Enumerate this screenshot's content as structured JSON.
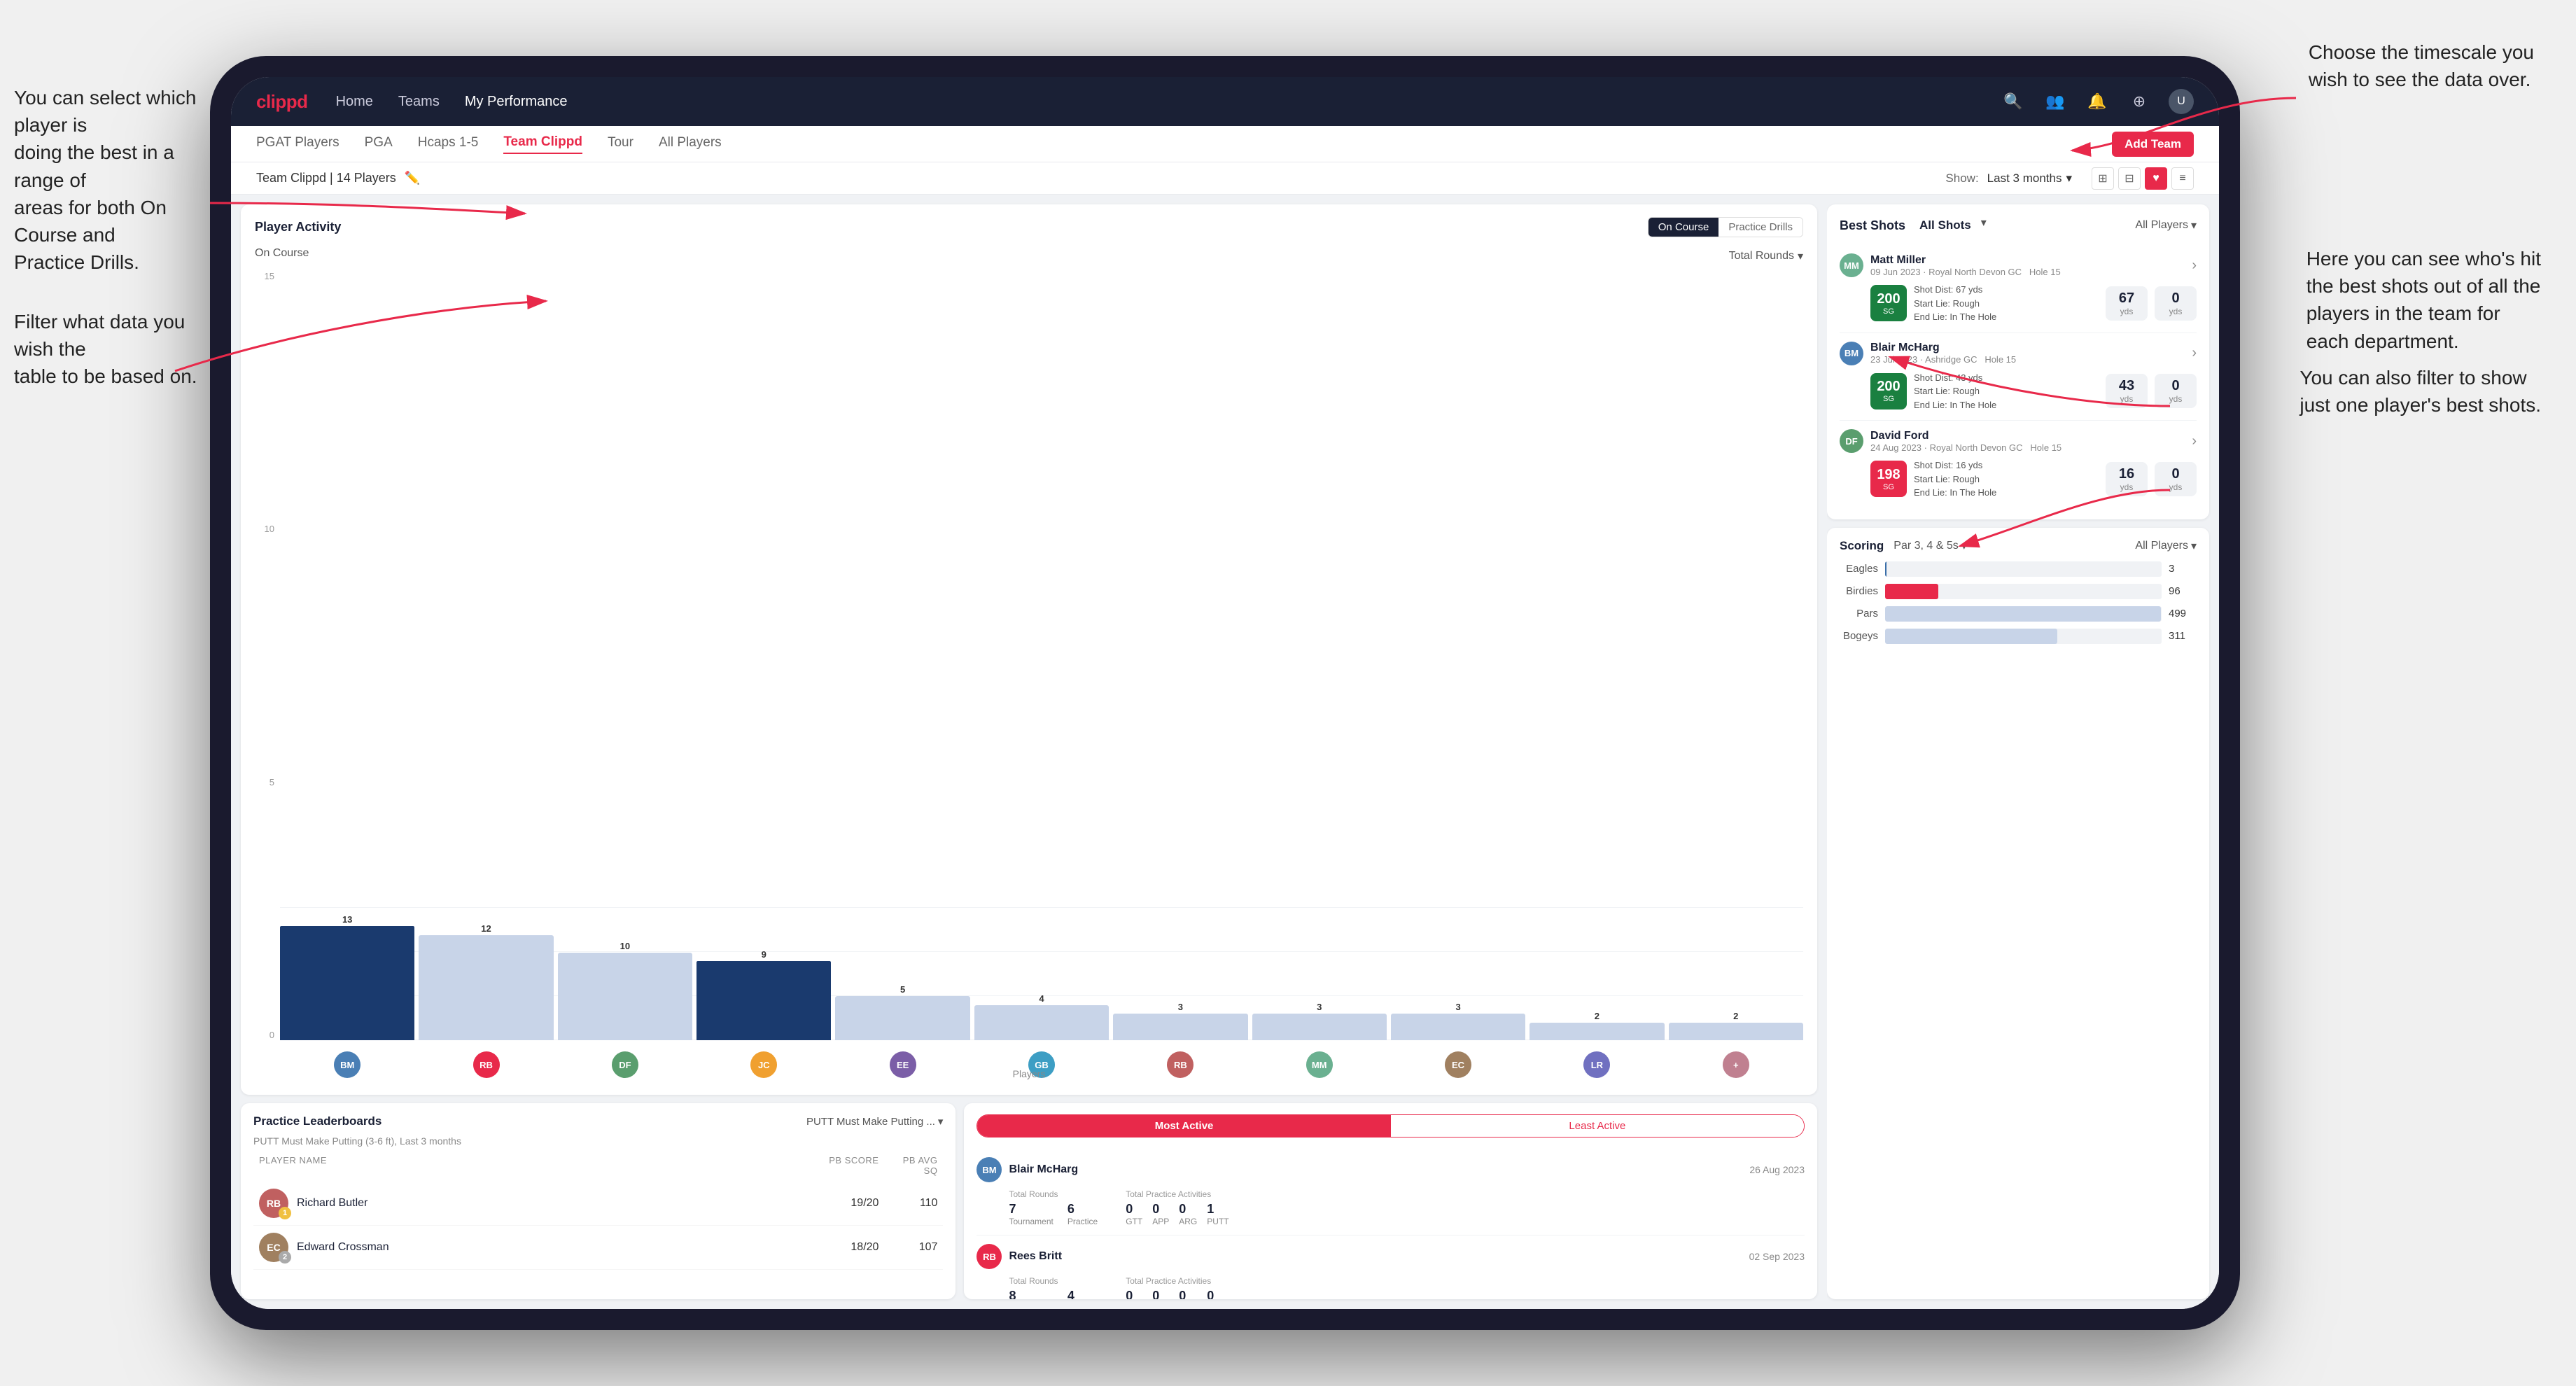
{
  "annotations": {
    "top_right": "Choose the timescale you\nwish to see the data over.",
    "top_left": "You can select which player is\ndoing the best in a range of\nareas for both On Course and\nPractice Drills.",
    "bottom_left": "Filter what data you wish the\ntable to be based on.",
    "right_mid": "Here you can see who's hit\nthe best shots out of all the\nplayers in the team for\neach department.",
    "right_bot": "You can also filter to show\njust one player's best shots."
  },
  "nav": {
    "logo": "clippd",
    "links": [
      "Home",
      "Teams",
      "My Performance"
    ],
    "icons": [
      "🔍",
      "👤",
      "🔔",
      "⊕",
      "👤"
    ]
  },
  "sub_nav": {
    "links": [
      "PGAT Players",
      "PGA",
      "Hcaps 1-5",
      "Team Clippd",
      "Tour",
      "All Players"
    ],
    "active": "Team Clippd",
    "add_btn": "Add Team"
  },
  "team_header": {
    "team_name": "Team Clippd | 14 Players",
    "show_label": "Show:",
    "show_value": "Last 3 months",
    "view_icons": [
      "⊞",
      "⊟",
      "♥",
      "≡"
    ]
  },
  "activity": {
    "title": "Player Activity",
    "toggle": [
      "On Course",
      "Practice Drills"
    ],
    "active_toggle": "On Course",
    "section": "On Course",
    "chart_filter": "Total Rounds",
    "x_axis_label": "Players",
    "y_labels": [
      "15",
      "10",
      "5",
      "0"
    ],
    "bars": [
      {
        "label": "13",
        "player": "B. McHarg",
        "height": 87,
        "highlighted": true,
        "color": "#1a3a6e"
      },
      {
        "label": "12",
        "player": "R. Britt",
        "height": 80,
        "highlighted": false
      },
      {
        "label": "10",
        "player": "D. Ford",
        "height": 67,
        "highlighted": false
      },
      {
        "label": "9",
        "player": "J. Coles",
        "height": 60,
        "highlighted": true
      },
      {
        "label": "5",
        "player": "E. Ebert",
        "height": 33,
        "highlighted": false
      },
      {
        "label": "4",
        "player": "G. Billingham",
        "height": 27,
        "highlighted": false
      },
      {
        "label": "3",
        "player": "R. Butler",
        "height": 20,
        "highlighted": false
      },
      {
        "label": "3",
        "player": "M. Miller",
        "height": 20,
        "highlighted": false
      },
      {
        "label": "3",
        "player": "E. Crossman",
        "height": 20,
        "highlighted": false
      },
      {
        "label": "2",
        "player": "L. Robertson",
        "height": 13,
        "highlighted": false
      },
      {
        "label": "2",
        "player": "other",
        "height": 13,
        "highlighted": false
      }
    ],
    "player_colors": [
      "#4a7fb5",
      "#e8294a",
      "#5a9e6e",
      "#f0a030",
      "#7b5ea7",
      "#3d9ec4",
      "#c06060",
      "#6ab090",
      "#a08060",
      "#7070c0",
      "#c08090"
    ]
  },
  "best_shots": {
    "title": "Best Shots",
    "tabs": [
      "Best Shots",
      "All Shots"
    ],
    "active_tab": "Best Shots",
    "all_shots_label": "All Shots",
    "players_filter": "All Players",
    "shots": [
      {
        "player_name": "Matt Miller",
        "date_course": "09 Jun 2023 · Royal North Devon GC",
        "hole": "Hole 15",
        "badge_value": "200",
        "badge_sub": "SG",
        "shot_dist": "Shot Dist: 67 yds",
        "start_lie": "Start Lie: Rough",
        "end_lie": "End Lie: In The Hole",
        "stat1_val": "67",
        "stat1_unit": "yds",
        "stat2_val": "0",
        "stat2_unit": "yds",
        "badge_color": "green"
      },
      {
        "player_name": "Blair McHarg",
        "date_course": "23 Jul 2023 · Ashridge GC",
        "hole": "Hole 15",
        "badge_value": "200",
        "badge_sub": "SG",
        "shot_dist": "Shot Dist: 43 yds",
        "start_lie": "Start Lie: Rough",
        "end_lie": "End Lie: In The Hole",
        "stat1_val": "43",
        "stat1_unit": "yds",
        "stat2_val": "0",
        "stat2_unit": "yds",
        "badge_color": "green"
      },
      {
        "player_name": "David Ford",
        "date_course": "24 Aug 2023 · Royal North Devon GC",
        "hole": "Hole 15",
        "badge_value": "198",
        "badge_sub": "SG",
        "shot_dist": "Shot Dist: 16 yds",
        "start_lie": "Start Lie: Rough",
        "end_lie": "End Lie: In The Hole",
        "stat1_val": "16",
        "stat1_unit": "yds",
        "stat2_val": "0",
        "stat2_unit": "yds",
        "badge_color": "red"
      }
    ]
  },
  "scoring": {
    "title": "Scoring",
    "filter1": "Par 3, 4 & 5s",
    "filter2": "All Players",
    "rows": [
      {
        "label": "Eagles",
        "value": 3,
        "max": 500,
        "color": "#3a6ea8",
        "display": "3"
      },
      {
        "label": "Birdies",
        "value": 96,
        "max": 500,
        "color": "#e8294a",
        "display": "96"
      },
      {
        "label": "Pars",
        "value": 499,
        "max": 500,
        "color": "#c8d4e8",
        "display": "499"
      },
      {
        "label": "Bogeys",
        "value": 311,
        "max": 500,
        "color": "#c8d4e8",
        "display": "311"
      }
    ]
  },
  "leaderboard": {
    "title": "Practice Leaderboards",
    "dropdown": "PUTT Must Make Putting ...",
    "subtitle": "PUTT Must Make Putting (3-6 ft), Last 3 months",
    "col_headers": [
      "PLAYER NAME",
      "PB SCORE",
      "PB AVG SQ"
    ],
    "players": [
      {
        "name": "Richard Butler",
        "rank": 1,
        "rank_color": "gold",
        "score": "19/20",
        "avg": "110"
      },
      {
        "name": "Edward Crossman",
        "rank": 2,
        "rank_color": "silver",
        "score": "18/20",
        "avg": "107"
      }
    ]
  },
  "most_active": {
    "tabs": [
      "Most Active",
      "Least Active"
    ],
    "active_tab": "Most Active",
    "players": [
      {
        "name": "Blair McHarg",
        "date": "26 Aug 2023",
        "total_rounds_label": "Total Rounds",
        "tournament": "7",
        "practice": "6",
        "total_practice_label": "Total Practice Activities",
        "gtt": "0",
        "app": "0",
        "arg": "0",
        "putt": "1"
      },
      {
        "name": "Rees Britt",
        "date": "02 Sep 2023",
        "total_rounds_label": "Total Rounds",
        "tournament": "8",
        "practice": "4",
        "total_practice_label": "Total Practice Activities",
        "gtt": "0",
        "app": "0",
        "arg": "0",
        "putt": "0"
      }
    ]
  }
}
